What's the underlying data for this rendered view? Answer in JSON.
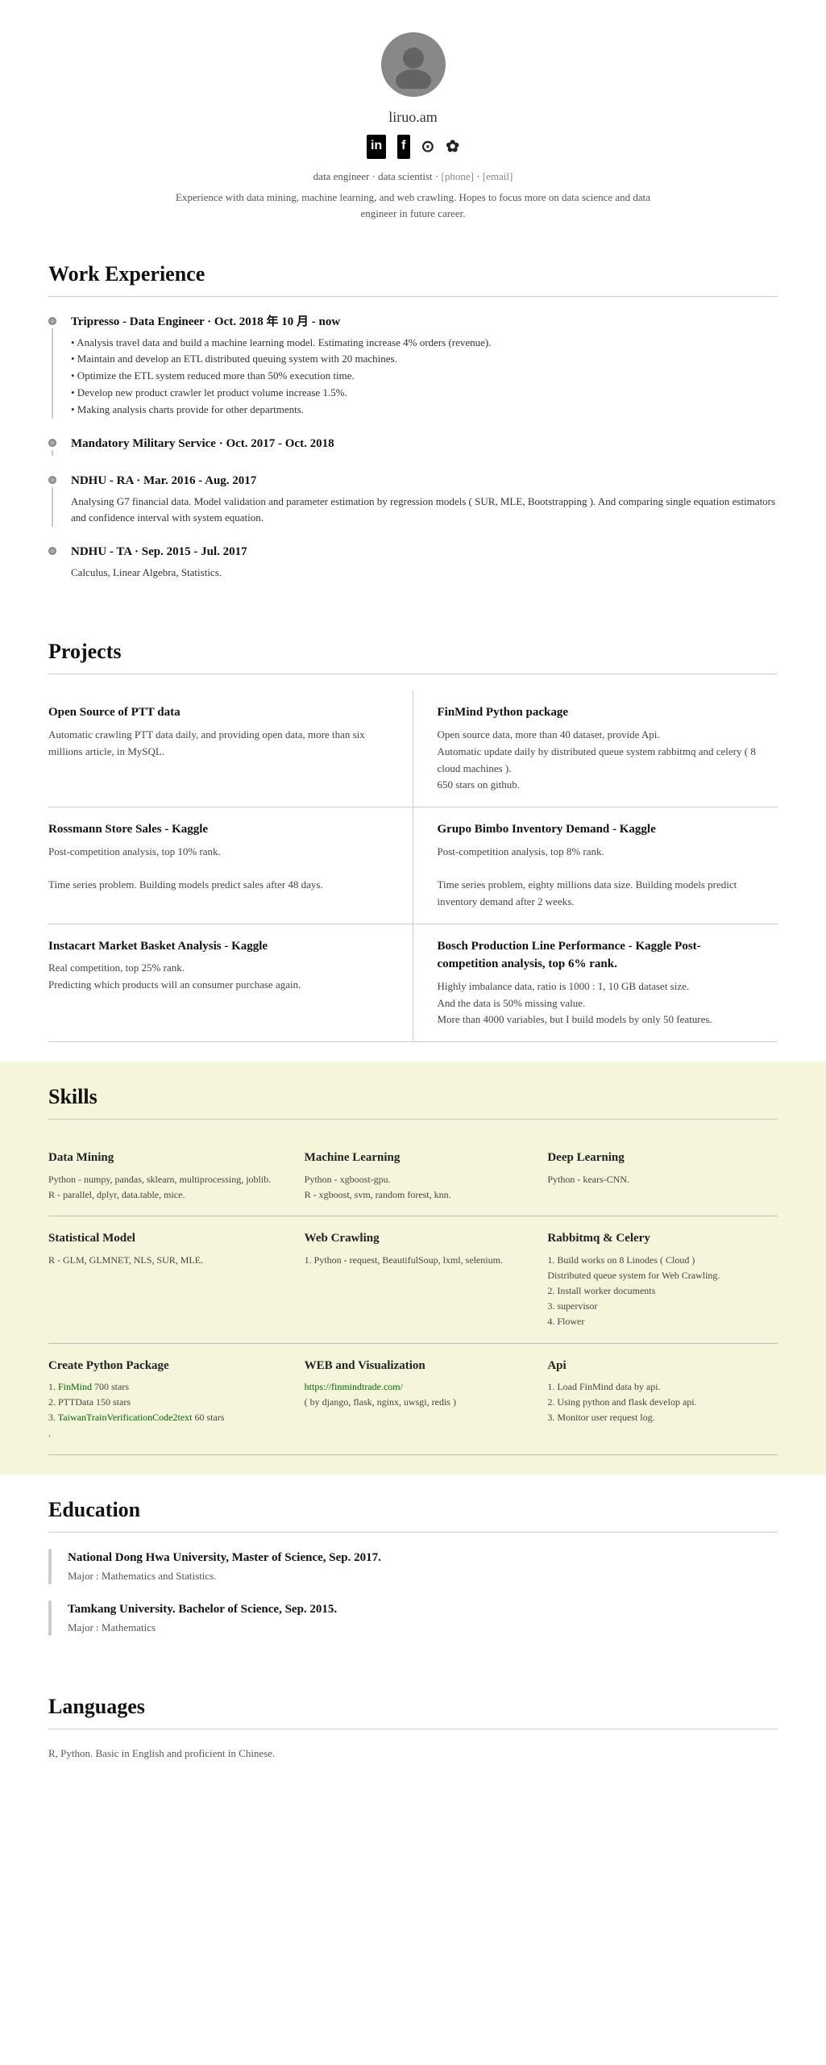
{
  "profile": {
    "name": "liruo.am",
    "description": "Experience with data mining, machine learning, and web crawling. Hopes to focus more on data science and data engineer in future career.",
    "subtitle": "data engineer · data scientist · [phone] · [email]",
    "social": [
      "in",
      "f",
      "◎",
      "✿"
    ]
  },
  "sections": {
    "work_experience": {
      "title": "Work Experience",
      "items": [
        {
          "title": "Tripresso - Data Engineer · Oct. 2018 年 10 月 - now",
          "desc": "• Analysis travel data and build a machine learning model. Estimating increase 4% orders (revenue).\n• Maintain and develop an ETL distributed queuing system with 20 machines.\n• Optimize the ETL system reduced more than 50% execution time.\n• Develop new product crawler let product volume increase 1.5%.\n• Making analysis charts provide for other departments."
        },
        {
          "title": "Mandatory Military Service · Oct. 2017 - Oct. 2018",
          "desc": ""
        },
        {
          "title": "NDHU - RA · Mar. 2016 - Aug. 2017",
          "desc": "Analysing G7 financial data. Model validation and parameter estimation by regression models ( SUR, MLE, Bootstrapping ). And comparing single equation estimators and confidence interval with system equation."
        },
        {
          "title": "NDHU - TA · Sep. 2015 - Jul. 2017",
          "desc": "Calculus, Linear Algebra, Statistics."
        }
      ]
    },
    "projects": {
      "title": "Projects",
      "items": [
        {
          "title": "Open Source of PTT data",
          "desc": "Automatic crawling PTT data daily, and providing open data, more than six millions article, in MySQL."
        },
        {
          "title": "FinMind Python package",
          "desc": "Open source data, more than 40 dataset, provide Api.\nAutomatic update daily by distributed queue system rabbitmq and celery ( 8 cloud machines ).\n650 stars on github."
        },
        {
          "title": "Rossmann Store Sales - Kaggle",
          "desc": "Post-competition analysis, top 10% rank.\n\nTime series problem. Building models predict sales after 48 days."
        },
        {
          "title": "Grupo Bimbo Inventory Demand - Kaggle",
          "desc": "Post-competition analysis, top 8% rank.\n\nTime series problem, eighty millions data size. Building models predict inventory demand after 2 weeks."
        },
        {
          "title": "Instacart Market Basket Analysis - Kaggle",
          "desc": "Real competition, top 25% rank.\nPredicting which products will an consumer purchase again."
        },
        {
          "title": "Bosch Production Line Performance - Kaggle Post-competition analysis, top 6% rank.",
          "desc": "Highly imbalance data, ratio is 1000 : 1, 10 GB dataset size.\nAnd the data is 50% missing value.\nMore than 4000 variables, but I build models by only 50 features."
        }
      ]
    },
    "skills": {
      "title": "Skills",
      "items": [
        {
          "title": "Data Mining",
          "desc": "Python - numpy, pandas, sklearn, multiprocessing, joblib.\nR - parallel, dplyr, data.table, mice."
        },
        {
          "title": "Machine Learning",
          "desc": "Python - xgboost-gpu.\nR - xgboost, svm, random forest, knn."
        },
        {
          "title": "Deep Learning",
          "desc": "Python - kears-CNN."
        },
        {
          "title": "Statistical Model",
          "desc": "R - GLM, GLMNET, NLS, SUR, MLE."
        },
        {
          "title": "Web Crawling",
          "desc": "1. Python - request, BeautifulSoup, lxml, selenium."
        },
        {
          "title": "Rabbitmq & Celery",
          "desc": "1. Build works on 8 Linodes ( Cloud )\nDistributed queue system for Web Crawling.\n2. Install worker documents\n3. supervisor\n4. Flower"
        },
        {
          "title": "Create Python Package",
          "desc": "1. FinMind 700 stars\n2. PTTData 150 stars\n3. TaiwanTrainVerificationCode2text 60 stars\n."
        },
        {
          "title": "WEB and Visualization",
          "desc_link": "https://finmindtrade.com/",
          "desc_after": "( by django, flask, nginx, uwsgi, redis )"
        },
        {
          "title": "Api",
          "desc": "1. Load FinMind data by api.\n2. Using python and flask develop api.\n3. Monitor user request log."
        }
      ]
    },
    "education": {
      "title": "Education",
      "items": [
        {
          "title": "National Dong Hwa University, Master of Science,  Sep. 2017.",
          "desc": "Major : Mathematics and Statistics."
        },
        {
          "title": "Tamkang University. Bachelor of Science, Sep. 2015.",
          "desc": "Major : Mathematics"
        }
      ]
    },
    "languages": {
      "title": "Languages",
      "desc": "R, Python. Basic in English and proficient in Chinese."
    }
  }
}
